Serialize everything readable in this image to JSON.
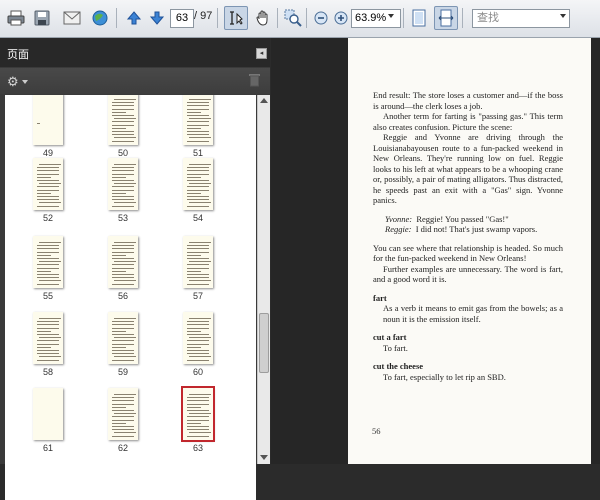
{
  "toolbar": {
    "current_page": "63",
    "page_total": "/ 97",
    "zoom": "63.9%",
    "search_placeholder": "查找"
  },
  "panel": {
    "title": "页面",
    "thumbnails": [
      {
        "label": "49"
      },
      {
        "label": "50"
      },
      {
        "label": "51"
      },
      {
        "label": "52"
      },
      {
        "label": "53"
      },
      {
        "label": "54"
      },
      {
        "label": "55"
      },
      {
        "label": "56"
      },
      {
        "label": "57"
      },
      {
        "label": "58"
      },
      {
        "label": "59"
      },
      {
        "label": "60"
      },
      {
        "label": "61"
      },
      {
        "label": "62"
      },
      {
        "label": "63",
        "selected": true
      }
    ]
  },
  "document": {
    "p1": "End result: The store loses a customer and—if the boss is around—the clerk loses a job.",
    "p2": "Another term for farting is \"passing gas.\" This term also creates confusion. Picture the scene:",
    "p3": "Reggie and Yvonne are driving through the Louisianabayousen route to a fun-packed weekend in New Orleans. They're running low on fuel. Reggie looks to his left at what appears to be a whooping crane or, possibly, a pair of mating alligators. Thus distracted, he speeds past an exit with a \"Gas\" sign. Yvonne panics.",
    "dialog1_speaker": "Yvonne:",
    "dialog1_text": "Reggie! You passed \"Gas!\"",
    "dialog2_speaker": "Reggie:",
    "dialog2_text": "I did not! That's just swamp vapors.",
    "p4": "You can see where that relationship is headed. So much for the fun-packed weekend in New Orleans!",
    "p5": "Further examples are unnecessary. The word is fart, and a good word it is.",
    "term1": "fart",
    "def1": "As a verb it means to emit gas from the bowels; as a noun it is the emission itself.",
    "term2": "cut a fart",
    "def2": "To fart.",
    "term3": "cut the cheese",
    "def3": "To fart, especially to let rip an SBD.",
    "page_number": "56"
  },
  "colors": {
    "selected_thumb_border": "#c1272d",
    "panel_bg": "#3a3a3a",
    "doc_bg": "#262626"
  }
}
